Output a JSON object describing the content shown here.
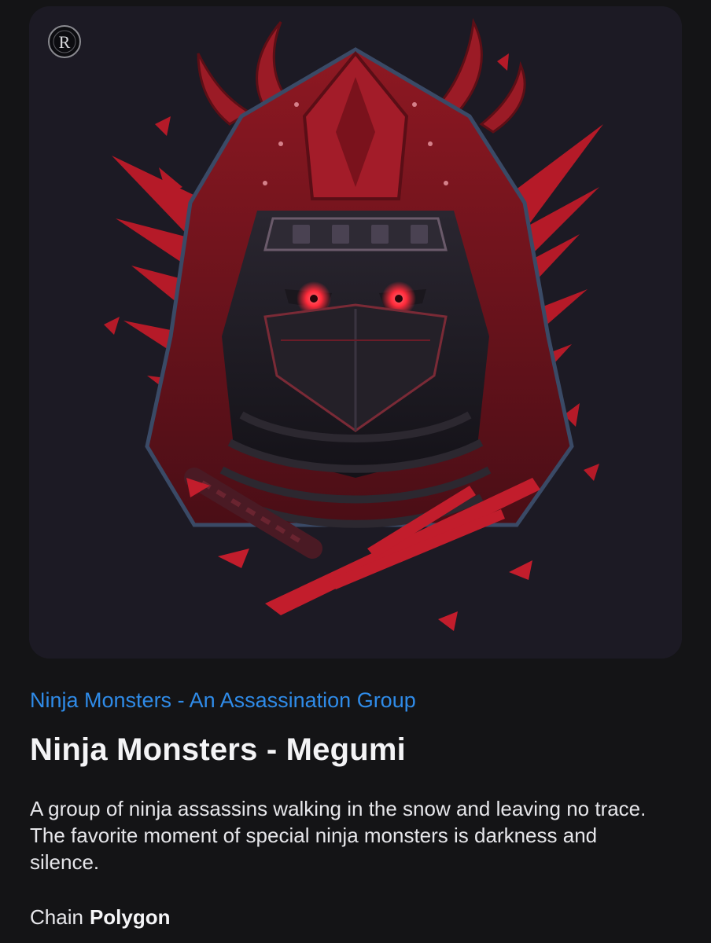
{
  "artwork": {
    "logo_letter": "R",
    "background_color": "#1c1a24",
    "accent_color": "#c21d2c",
    "eye_color": "#ff2a3a"
  },
  "collection": {
    "name": "Ninja Monsters - An Assassination Group",
    "link_color": "#2f8be8"
  },
  "nft": {
    "title": "Ninja Monsters - Megumi",
    "description": "A group of ninja assassins walking in the snow and leaving no trace. The favorite moment of special ninja monsters is darkness and silence."
  },
  "chain": {
    "label": "Chain",
    "value": "Polygon"
  }
}
